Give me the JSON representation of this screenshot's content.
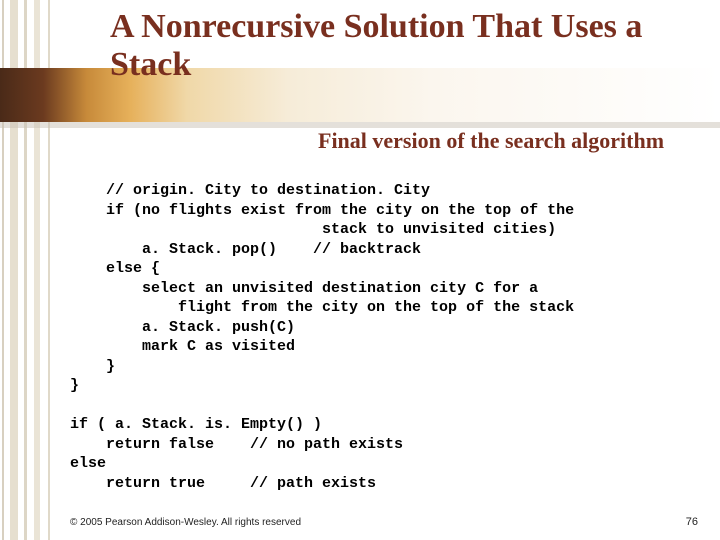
{
  "title": "A Nonrecursive Solution That Uses a Stack",
  "subtitle": "Final version of the search algorithm",
  "code": "    // origin. City to destination. City\n    if (no flights exist from the city on the top of the\n                            stack to unvisited cities)\n        a. Stack. pop()    // backtrack\n    else {\n        select an unvisited destination city C for a\n            flight from the city on the top of the stack\n        a. Stack. push(C)\n        mark C as visited\n    }\n}\n\nif ( a. Stack. is. Empty() )\n    return false    // no path exists\nelse\n    return true     // path exists",
  "footer": "© 2005 Pearson Addison-Wesley. All rights reserved",
  "page_number": "76"
}
